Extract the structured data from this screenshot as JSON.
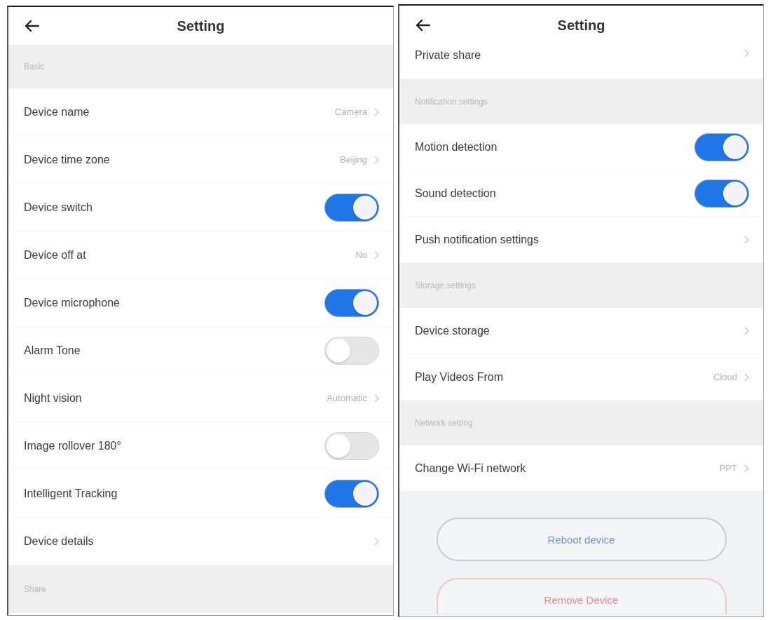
{
  "panels": [
    {
      "title": "Setting",
      "items": [
        {
          "kind": "section",
          "label": "Basic"
        },
        {
          "kind": "link",
          "label": "Device name",
          "value": "Camera"
        },
        {
          "kind": "link",
          "label": "Device time zone",
          "value": "Beijing"
        },
        {
          "kind": "toggle",
          "label": "Device switch",
          "on": true
        },
        {
          "kind": "link",
          "label": "Device off at",
          "value": "No"
        },
        {
          "kind": "toggle",
          "label": "Device microphone",
          "on": true
        },
        {
          "kind": "toggle",
          "label": "Alarm Tone",
          "on": false
        },
        {
          "kind": "link",
          "label": "Night vision",
          "value": "Automatic"
        },
        {
          "kind": "toggle",
          "label": "Image rollover 180°",
          "on": false
        },
        {
          "kind": "toggle",
          "label": "Intelligent Tracking",
          "on": true
        },
        {
          "kind": "link",
          "label": "Device details"
        },
        {
          "kind": "section",
          "label": "Share"
        }
      ]
    },
    {
      "title": "Setting",
      "items": [
        {
          "kind": "link",
          "label": "Private share"
        },
        {
          "kind": "section",
          "label": "Notification settings"
        },
        {
          "kind": "toggle",
          "label": "Motion detection",
          "on": true
        },
        {
          "kind": "toggle",
          "label": "Sound detection",
          "on": true
        },
        {
          "kind": "link",
          "label": "Push notification settings"
        },
        {
          "kind": "section",
          "label": "Storage settings"
        },
        {
          "kind": "link",
          "label": "Device storage"
        },
        {
          "kind": "link",
          "label": "Play Videos From",
          "value": "Cloud"
        },
        {
          "kind": "section",
          "label": "Network setting"
        },
        {
          "kind": "link",
          "label": "Change Wi-Fi network",
          "value": "PPT"
        }
      ],
      "buttons": [
        {
          "kind": "neutral",
          "label": "Reboot device"
        },
        {
          "kind": "danger",
          "label": "Remove Device"
        }
      ]
    }
  ]
}
